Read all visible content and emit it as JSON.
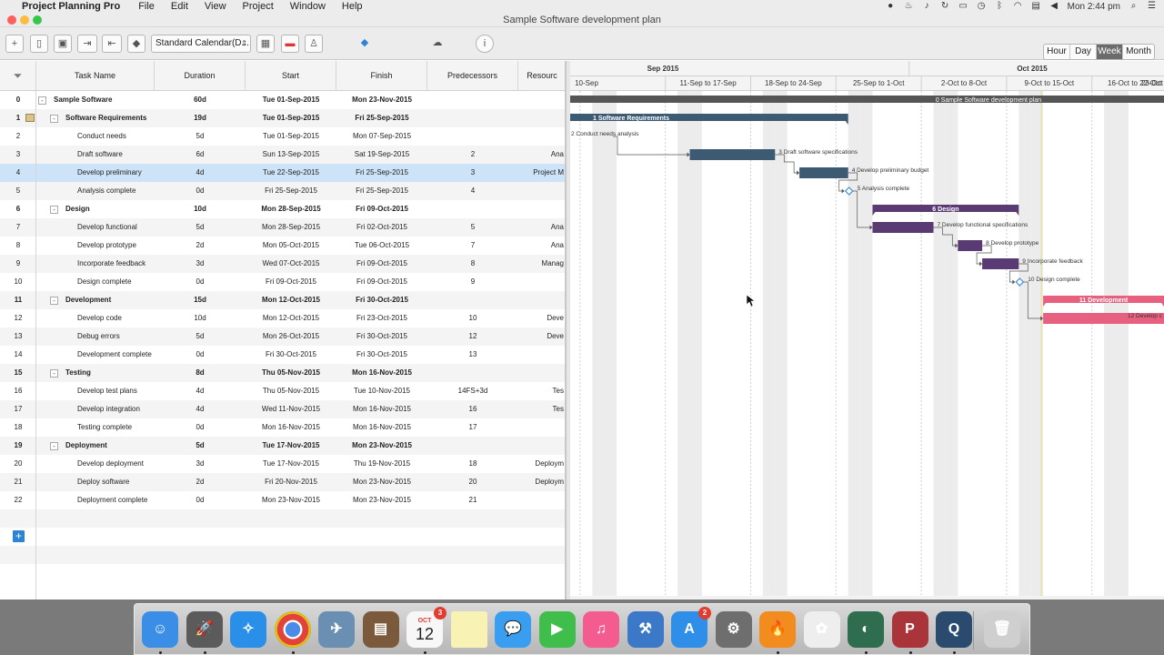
{
  "menubar": {
    "apple": "",
    "app_name": "Project Planning Pro",
    "items": [
      "File",
      "Edit",
      "View",
      "Project",
      "Window",
      "Help"
    ],
    "clock": "Mon 2:44 pm"
  },
  "window": {
    "title": "Sample Software development plan"
  },
  "toolbar": {
    "calendar_select": "Standard Calendar(D...",
    "view_modes": [
      "Hour",
      "Day",
      "Week",
      "Month"
    ],
    "selected_view": "Week"
  },
  "grid": {
    "columns": [
      "Task Name",
      "Duration",
      "Start",
      "Finish",
      "Predecessors",
      "Resourc"
    ],
    "rows": [
      {
        "id": "0",
        "name": "Sample Software",
        "dur": "60d",
        "start": "Tue 01-Sep-2015",
        "finish": "Mon 23-Nov-2015",
        "pred": "",
        "res": "",
        "summary": true,
        "level": 0
      },
      {
        "id": "1",
        "name": "Software Requirements",
        "dur": "19d",
        "start": "Tue 01-Sep-2015",
        "finish": "Fri 25-Sep-2015",
        "pred": "",
        "res": "",
        "summary": true,
        "level": 1,
        "note": true
      },
      {
        "id": "2",
        "name": "Conduct needs",
        "dur": "5d",
        "start": "Tue 01-Sep-2015",
        "finish": "Mon 07-Sep-2015",
        "pred": "",
        "res": "",
        "summary": false,
        "level": 2
      },
      {
        "id": "3",
        "name": "Draft software",
        "dur": "6d",
        "start": "Sun 13-Sep-2015",
        "finish": "Sat 19-Sep-2015",
        "pred": "2",
        "res": "Ana",
        "summary": false,
        "level": 2
      },
      {
        "id": "4",
        "name": "Develop preliminary",
        "dur": "4d",
        "start": "Tue 22-Sep-2015",
        "finish": "Fri 25-Sep-2015",
        "pred": "3",
        "res": "Project M",
        "summary": false,
        "level": 2,
        "selected": true
      },
      {
        "id": "5",
        "name": "Analysis complete",
        "dur": "0d",
        "start": "Fri 25-Sep-2015",
        "finish": "Fri 25-Sep-2015",
        "pred": "4",
        "res": "",
        "summary": false,
        "level": 2
      },
      {
        "id": "6",
        "name": "Design",
        "dur": "10d",
        "start": "Mon 28-Sep-2015",
        "finish": "Fri 09-Oct-2015",
        "pred": "",
        "res": "",
        "summary": true,
        "level": 1
      },
      {
        "id": "7",
        "name": "Develop functional",
        "dur": "5d",
        "start": "Mon 28-Sep-2015",
        "finish": "Fri 02-Oct-2015",
        "pred": "5",
        "res": "Ana",
        "summary": false,
        "level": 2
      },
      {
        "id": "8",
        "name": "Develop prototype",
        "dur": "2d",
        "start": "Mon 05-Oct-2015",
        "finish": "Tue 06-Oct-2015",
        "pred": "7",
        "res": "Ana",
        "summary": false,
        "level": 2
      },
      {
        "id": "9",
        "name": "Incorporate feedback",
        "dur": "3d",
        "start": "Wed 07-Oct-2015",
        "finish": "Fri 09-Oct-2015",
        "pred": "8",
        "res": "Manag",
        "summary": false,
        "level": 2
      },
      {
        "id": "10",
        "name": "Design complete",
        "dur": "0d",
        "start": "Fri 09-Oct-2015",
        "finish": "Fri 09-Oct-2015",
        "pred": "9",
        "res": "",
        "summary": false,
        "level": 2
      },
      {
        "id": "11",
        "name": "Development",
        "dur": "15d",
        "start": "Mon 12-Oct-2015",
        "finish": "Fri 30-Oct-2015",
        "pred": "",
        "res": "",
        "summary": true,
        "level": 1
      },
      {
        "id": "12",
        "name": "Develop code",
        "dur": "10d",
        "start": "Mon 12-Oct-2015",
        "finish": "Fri 23-Oct-2015",
        "pred": "10",
        "res": "Deve",
        "summary": false,
        "level": 2
      },
      {
        "id": "13",
        "name": "Debug errors",
        "dur": "5d",
        "start": "Mon 26-Oct-2015",
        "finish": "Fri 30-Oct-2015",
        "pred": "12",
        "res": "Deve",
        "summary": false,
        "level": 2
      },
      {
        "id": "14",
        "name": "Development complete",
        "dur": "0d",
        "start": "Fri 30-Oct-2015",
        "finish": "Fri 30-Oct-2015",
        "pred": "13",
        "res": "",
        "summary": false,
        "level": 2
      },
      {
        "id": "15",
        "name": "Testing",
        "dur": "8d",
        "start": "Thu 05-Nov-2015",
        "finish": "Mon 16-Nov-2015",
        "pred": "",
        "res": "",
        "summary": true,
        "level": 1
      },
      {
        "id": "16",
        "name": "Develop test plans",
        "dur": "4d",
        "start": "Thu 05-Nov-2015",
        "finish": "Tue 10-Nov-2015",
        "pred": "14FS+3d",
        "res": "Tes",
        "summary": false,
        "level": 2
      },
      {
        "id": "17",
        "name": "Develop integration",
        "dur": "4d",
        "start": "Wed 11-Nov-2015",
        "finish": "Mon 16-Nov-2015",
        "pred": "16",
        "res": "Tes",
        "summary": false,
        "level": 2
      },
      {
        "id": "18",
        "name": "Testing complete",
        "dur": "0d",
        "start": "Mon 16-Nov-2015",
        "finish": "Mon 16-Nov-2015",
        "pred": "17",
        "res": "",
        "summary": false,
        "level": 2
      },
      {
        "id": "19",
        "name": "Deployment",
        "dur": "5d",
        "start": "Tue 17-Nov-2015",
        "finish": "Mon 23-Nov-2015",
        "pred": "",
        "res": "",
        "summary": true,
        "level": 1
      },
      {
        "id": "20",
        "name": "Develop deployment",
        "dur": "3d",
        "start": "Tue 17-Nov-2015",
        "finish": "Thu 19-Nov-2015",
        "pred": "18",
        "res": "Deploym",
        "summary": false,
        "level": 2
      },
      {
        "id": "21",
        "name": "Deploy software",
        "dur": "2d",
        "start": "Fri 20-Nov-2015",
        "finish": "Mon 23-Nov-2015",
        "pred": "20",
        "res": "Deploym",
        "summary": false,
        "level": 2
      },
      {
        "id": "22",
        "name": "Deployment complete",
        "dur": "0d",
        "start": "Mon 23-Nov-2015",
        "finish": "Mon 23-Nov-2015",
        "pred": "21",
        "res": "",
        "summary": false,
        "level": 2
      }
    ]
  },
  "gantt": {
    "months": [
      "Sep 2015",
      "Oct 2015"
    ],
    "weeks": [
      "10-Sep",
      "11-Sep to 17-Sep",
      "18-Sep to 24-Sep",
      "25-Sep to 1-Oct",
      "2-Oct to 8-Oct",
      "9-Oct to 15-Oct",
      "16-Oct to 22-Oct",
      "23-Oct"
    ],
    "bar_labels": {
      "0": "0 Sample Software development plan",
      "1": "1 Software Requirements",
      "2": "2 Conduct needs analysis",
      "3": "3 Draft software specifications",
      "4": "4 Develop preliminary budget",
      "5": "5 Analysis complete",
      "6": "6 Design",
      "7": "7 Develop functional specifications",
      "8": "8 Develop prototype",
      "9": "9 Incorporate feedback",
      "10": "10 Design complete",
      "11": "11 Development",
      "12": "12 Develop c"
    },
    "colors": {
      "requirements": "#3d5a73",
      "design": "#5a3a73",
      "development": "#e8607f",
      "summary": "#555555",
      "milestone": "#3d8fd6",
      "today": "#e6e08a"
    }
  },
  "dock": {
    "apps": [
      "finder-icon",
      "launchpad-icon",
      "safari-icon",
      "chrome-icon",
      "preview-icon",
      "notebook-icon",
      "calendar-icon",
      "notes-icon",
      "messages-icon",
      "facetime-icon",
      "itunes-icon",
      "xcode-icon",
      "appstore-icon",
      "system-preferences-icon",
      "burn-icon",
      "photos-icon",
      "project-icon",
      "powerpoint-icon",
      "quicktime-icon",
      "trash-icon"
    ],
    "calendar_day": "12",
    "calendar_month": "OCT",
    "calendar_badge": "3",
    "appstore_badge": "2"
  }
}
